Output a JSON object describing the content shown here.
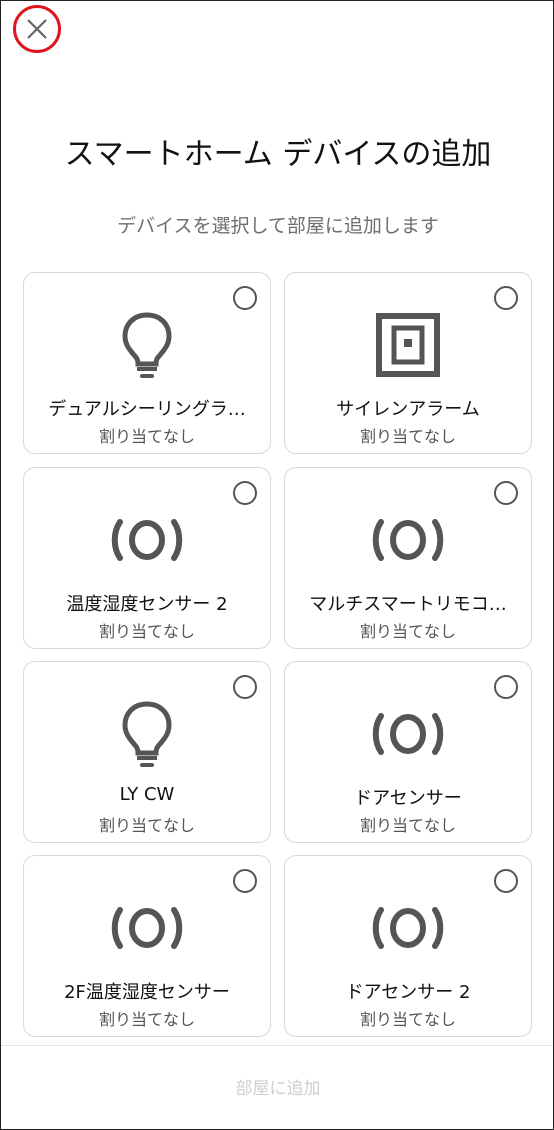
{
  "header": {
    "close_icon": "close-icon",
    "title": "スマートホーム デバイスの追加",
    "subtitle": "デバイスを選択して部屋に追加します"
  },
  "devices": [
    {
      "name": "デュアルシーリングラ…",
      "status": "割り当てなし",
      "icon": "bulb-icon",
      "selected": false
    },
    {
      "name": "サイレンアラーム",
      "status": "割り当てなし",
      "icon": "siren-icon",
      "selected": false
    },
    {
      "name": "温度湿度センサー 2",
      "status": "割り当てなし",
      "icon": "sensor-icon",
      "selected": false
    },
    {
      "name": "マルチスマートリモコ…",
      "status": "割り当てなし",
      "icon": "sensor-icon",
      "selected": false
    },
    {
      "name": "LY CW",
      "status": "割り当てなし",
      "icon": "bulb-icon",
      "selected": false
    },
    {
      "name": "ドアセンサー",
      "status": "割り当てなし",
      "icon": "sensor-icon",
      "selected": false
    },
    {
      "name": "2F温度湿度センサー",
      "status": "割り当てなし",
      "icon": "sensor-icon",
      "selected": false
    },
    {
      "name": "ドアセンサー 2",
      "status": "割り当てなし",
      "icon": "sensor-icon",
      "selected": false
    }
  ],
  "footer": {
    "add_button_label": "部屋に追加"
  },
  "colors": {
    "close_ring": "#e0161e",
    "icon": "#555555",
    "disabled_text": "#cfcfcf"
  }
}
